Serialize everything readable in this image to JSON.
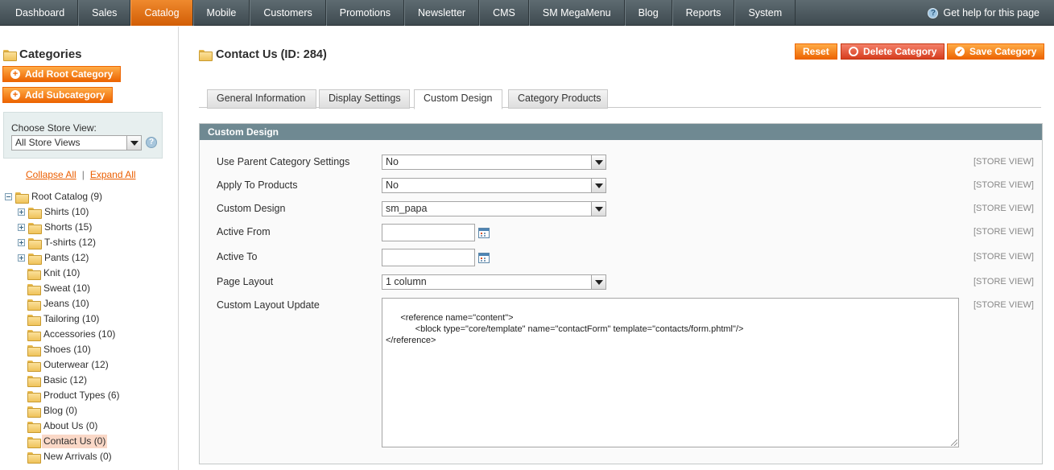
{
  "nav": {
    "items": [
      "Dashboard",
      "Sales",
      "Catalog",
      "Mobile",
      "Customers",
      "Promotions",
      "Newsletter",
      "CMS",
      "SM MegaMenu",
      "Blog",
      "Reports",
      "System"
    ],
    "active": "Catalog",
    "help": "Get help for this page"
  },
  "sidebar": {
    "title": "Categories",
    "add_root": "Add Root Category",
    "add_sub": "Add Subcategory",
    "store_view_label": "Choose Store View:",
    "store_view_value": "All Store Views",
    "collapse_all": "Collapse All",
    "separator": "|",
    "expand_all": "Expand All",
    "tree": [
      {
        "label": "Root Catalog (9)",
        "level": 0,
        "toggle": "minus"
      },
      {
        "label": "Shirts (10)",
        "level": 1,
        "toggle": "plus"
      },
      {
        "label": "Shorts (15)",
        "level": 1,
        "toggle": "plus"
      },
      {
        "label": "T-shirts (12)",
        "level": 1,
        "toggle": "plus"
      },
      {
        "label": "Pants (12)",
        "level": 1,
        "toggle": "plus"
      },
      {
        "label": "Knit (10)",
        "level": 1,
        "toggle": ""
      },
      {
        "label": "Sweat (10)",
        "level": 1,
        "toggle": ""
      },
      {
        "label": "Jeans (10)",
        "level": 1,
        "toggle": ""
      },
      {
        "label": "Tailoring (10)",
        "level": 1,
        "toggle": ""
      },
      {
        "label": "Accessories (10)",
        "level": 1,
        "toggle": ""
      },
      {
        "label": "Shoes (10)",
        "level": 1,
        "toggle": ""
      },
      {
        "label": "Outerwear (12)",
        "level": 1,
        "toggle": ""
      },
      {
        "label": "Basic (12)",
        "level": 1,
        "toggle": ""
      },
      {
        "label": "Product Types (6)",
        "level": 1,
        "toggle": ""
      },
      {
        "label": "Blog (0)",
        "level": 1,
        "toggle": ""
      },
      {
        "label": "About Us (0)",
        "level": 1,
        "toggle": ""
      },
      {
        "label": "Contact Us (0)",
        "level": 1,
        "toggle": "",
        "selected": true
      },
      {
        "label": "New Arrivals (0)",
        "level": 1,
        "toggle": ""
      }
    ]
  },
  "main": {
    "title": "Contact Us (ID: 284)",
    "buttons": {
      "reset": "Reset",
      "delete": "Delete Category",
      "save": "Save Category"
    },
    "tabs": [
      "General Information",
      "Display Settings",
      "Custom Design",
      "Category Products"
    ],
    "active_tab": "Custom Design",
    "section_title": "Custom Design",
    "scope_label": "[STORE VIEW]",
    "fields": {
      "use_parent": {
        "label": "Use Parent Category Settings",
        "value": "No"
      },
      "apply_products": {
        "label": "Apply To Products",
        "value": "No"
      },
      "custom_design": {
        "label": "Custom Design",
        "value": "sm_papa"
      },
      "active_from": {
        "label": "Active From",
        "value": ""
      },
      "active_to": {
        "label": "Active To",
        "value": ""
      },
      "page_layout": {
        "label": "Page Layout",
        "value": "1 column"
      },
      "layout_update": {
        "label": "Custom Layout Update",
        "value": "<reference name=\"content\">\n            <block type=\"core/template\" name=\"contactForm\" template=\"contacts/form.phtml\"/>\n</reference>"
      }
    }
  },
  "colors": {
    "accent": "#eb5e00",
    "nav_bg": "#4f5b61",
    "section_header": "#6f8992",
    "delete_button": "#d63e1f"
  }
}
